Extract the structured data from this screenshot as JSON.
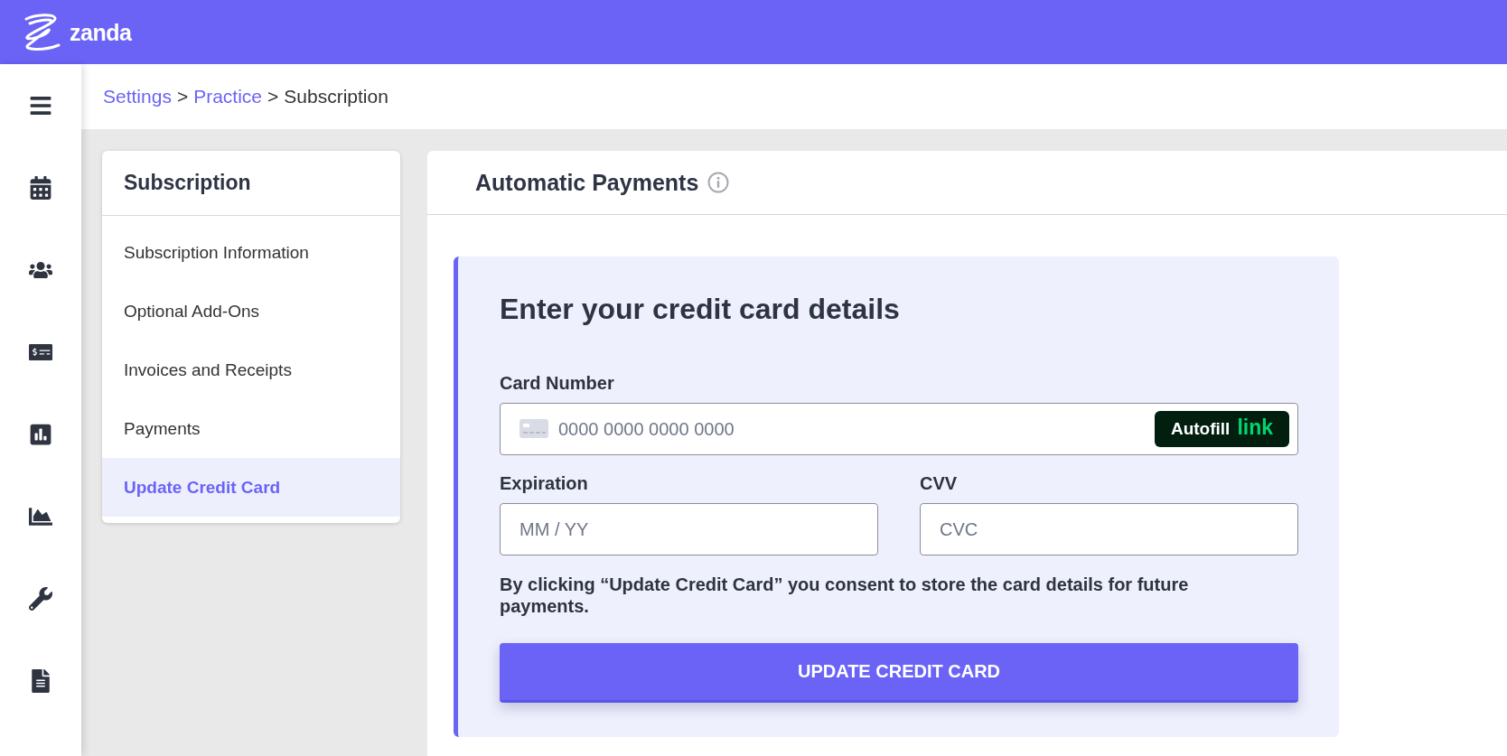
{
  "top_bar": {
    "logo_text": "zanda"
  },
  "breadcrumb": [
    {
      "kind": "link",
      "label": "Settings"
    },
    {
      "kind": "separator",
      "label": ">"
    },
    {
      "kind": "link",
      "label": "Practice"
    },
    {
      "kind": "separator",
      "label": ">"
    },
    {
      "kind": "current",
      "label": "Subscription"
    }
  ],
  "subnav": {
    "title": "Subscription",
    "items": [
      {
        "label": "Subscription Information",
        "selected": false
      },
      {
        "label": "Optional Add-Ons",
        "selected": false
      },
      {
        "label": "Invoices and Receipts",
        "selected": false
      },
      {
        "label": "Payments",
        "selected": false
      },
      {
        "label": "Update Credit Card",
        "selected": true
      }
    ]
  },
  "panel": {
    "title": "Automatic Payments",
    "form": {
      "title": "Enter your credit card details",
      "card_number": {
        "label": "Card Number",
        "placeholder": "0000 0000 0000 0000",
        "autofill_button": {
          "label": "Autofill",
          "brand": "link"
        }
      },
      "expiration": {
        "label": "Expiration",
        "placeholder": "MM / YY"
      },
      "cvv": {
        "label": "CVV",
        "placeholder": "CVC"
      },
      "consent": "By clicking “Update Credit Card” you consent to store the card details for future payments.",
      "submit_button": "UPDATE CREDIT CARD"
    }
  }
}
